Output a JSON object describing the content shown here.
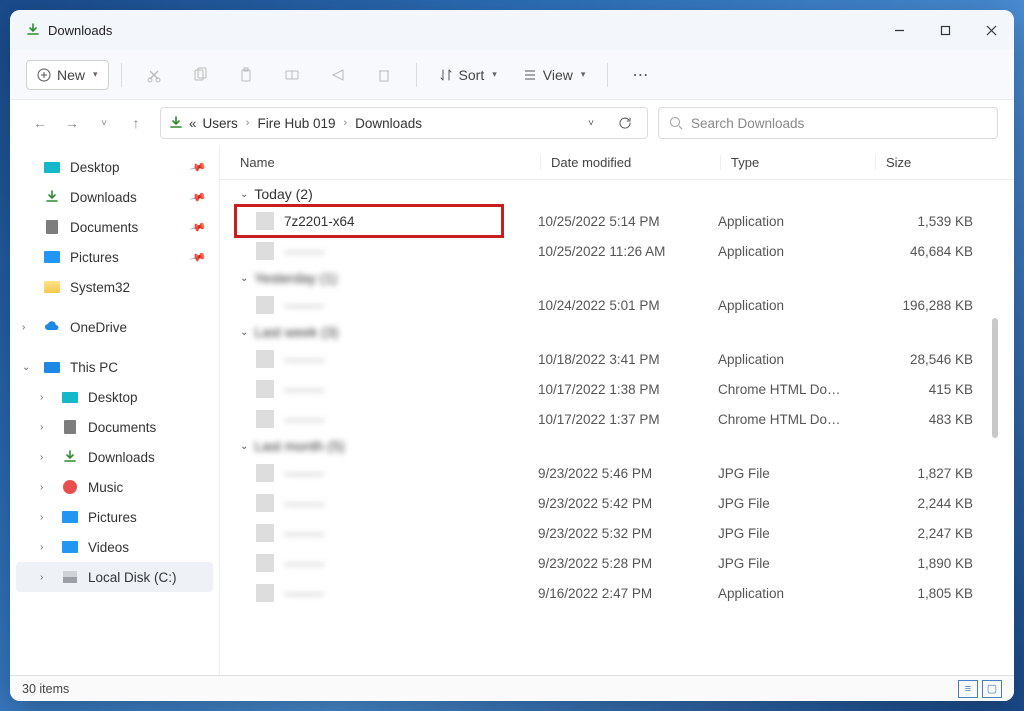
{
  "title": "Downloads",
  "toolbar": {
    "new_label": "New",
    "sort_label": "Sort",
    "view_label": "View"
  },
  "breadcrumb": {
    "prefix": "«",
    "parts": [
      "Users",
      "Fire Hub 019",
      "Downloads"
    ]
  },
  "search": {
    "placeholder": "Search Downloads"
  },
  "sidebar": {
    "top": [
      {
        "label": "Desktop",
        "icon": "desktop"
      },
      {
        "label": "Downloads",
        "icon": "download"
      },
      {
        "label": "Documents",
        "icon": "document"
      },
      {
        "label": "Pictures",
        "icon": "picture"
      },
      {
        "label": "System32",
        "icon": "folder"
      }
    ],
    "onedrive_label": "OneDrive",
    "thispc_label": "This PC",
    "thispc_children": [
      {
        "label": "Desktop",
        "icon": "desktop"
      },
      {
        "label": "Documents",
        "icon": "document"
      },
      {
        "label": "Downloads",
        "icon": "download"
      },
      {
        "label": "Music",
        "icon": "music"
      },
      {
        "label": "Pictures",
        "icon": "picture"
      },
      {
        "label": "Videos",
        "icon": "video"
      },
      {
        "label": "Local Disk (C:)",
        "icon": "disk"
      }
    ]
  },
  "columns": {
    "name": "Name",
    "date": "Date modified",
    "type": "Type",
    "size": "Size"
  },
  "groups": [
    {
      "label": "Today (2)",
      "rows": [
        {
          "name": "7z2201-x64",
          "date": "10/25/2022 5:14 PM",
          "type": "Application",
          "size": "1,539 KB",
          "highlight": true
        },
        {
          "name": "———",
          "date": "10/25/2022 11:26 AM",
          "type": "Application",
          "size": "46,684 KB",
          "blurred": true
        }
      ]
    },
    {
      "label": "Yesterday (1)",
      "blurred": true,
      "rows": [
        {
          "name": "———",
          "date": "10/24/2022 5:01 PM",
          "type": "Application",
          "size": "196,288 KB",
          "blurred": true
        }
      ]
    },
    {
      "label": "Last week (3)",
      "blurred": true,
      "rows": [
        {
          "name": "———",
          "date": "10/18/2022 3:41 PM",
          "type": "Application",
          "size": "28,546 KB",
          "blurred": true
        },
        {
          "name": "———",
          "date": "10/17/2022 1:38 PM",
          "type": "Chrome HTML Do…",
          "size": "415 KB",
          "blurred": true
        },
        {
          "name": "———",
          "date": "10/17/2022 1:37 PM",
          "type": "Chrome HTML Do…",
          "size": "483 KB",
          "blurred": true
        }
      ]
    },
    {
      "label": "Last month (5)",
      "blurred": true,
      "rows": [
        {
          "name": "———",
          "date": "9/23/2022 5:46 PM",
          "type": "JPG File",
          "size": "1,827 KB",
          "blurred": true
        },
        {
          "name": "———",
          "date": "9/23/2022 5:42 PM",
          "type": "JPG File",
          "size": "2,244 KB",
          "blurred": true
        },
        {
          "name": "———",
          "date": "9/23/2022 5:32 PM",
          "type": "JPG File",
          "size": "2,247 KB",
          "blurred": true
        },
        {
          "name": "———",
          "date": "9/23/2022 5:28 PM",
          "type": "JPG File",
          "size": "1,890 KB",
          "blurred": true
        },
        {
          "name": "———",
          "date": "9/16/2022 2:47 PM",
          "type": "Application",
          "size": "1,805 KB",
          "blurred": true
        }
      ]
    }
  ],
  "status": {
    "items": "30 items"
  }
}
